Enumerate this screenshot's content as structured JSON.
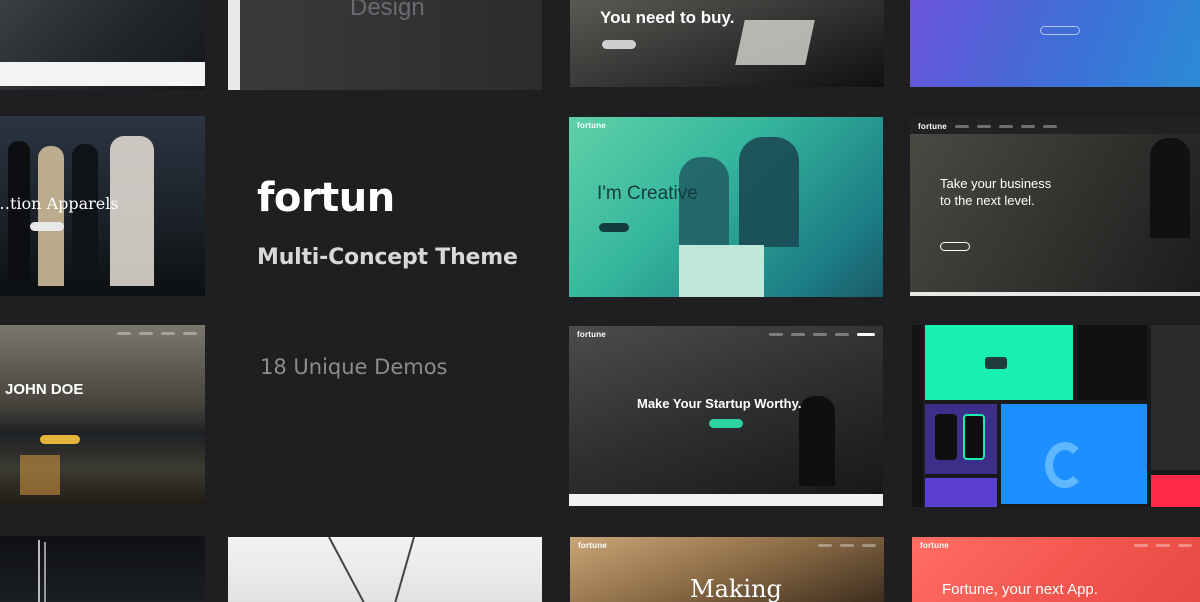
{
  "hero": {
    "brand": "fortun",
    "tagline": "Multi-Concept Theme",
    "demos": "18 Unique Demos"
  },
  "tiles": {
    "design": {
      "headline": "Design"
    },
    "buy": {
      "headline": "You need to buy."
    },
    "fashion": {
      "headline": "…tion Apparels"
    },
    "creative": {
      "logo": "fortune",
      "headline": "I'm Creative"
    },
    "business": {
      "logo": "fortune",
      "headline_line1": "Take your business",
      "headline_line2": "to the next level."
    },
    "john": {
      "headline": "JOHN DOE"
    },
    "startup": {
      "logo": "fortune",
      "headline": "Make Your Startup Worthy."
    },
    "making": {
      "logo": "fortune",
      "headline": "Making"
    },
    "app": {
      "logo": "fortune",
      "headline": "Fortune, your next App."
    }
  },
  "colors": {
    "background": "#1f1f21",
    "teal_accent": "#2fd3a0",
    "coral": "#f1544c",
    "purple": "#6a54d8",
    "neon_green": "#19f0b0",
    "blue": "#1d8fff"
  }
}
